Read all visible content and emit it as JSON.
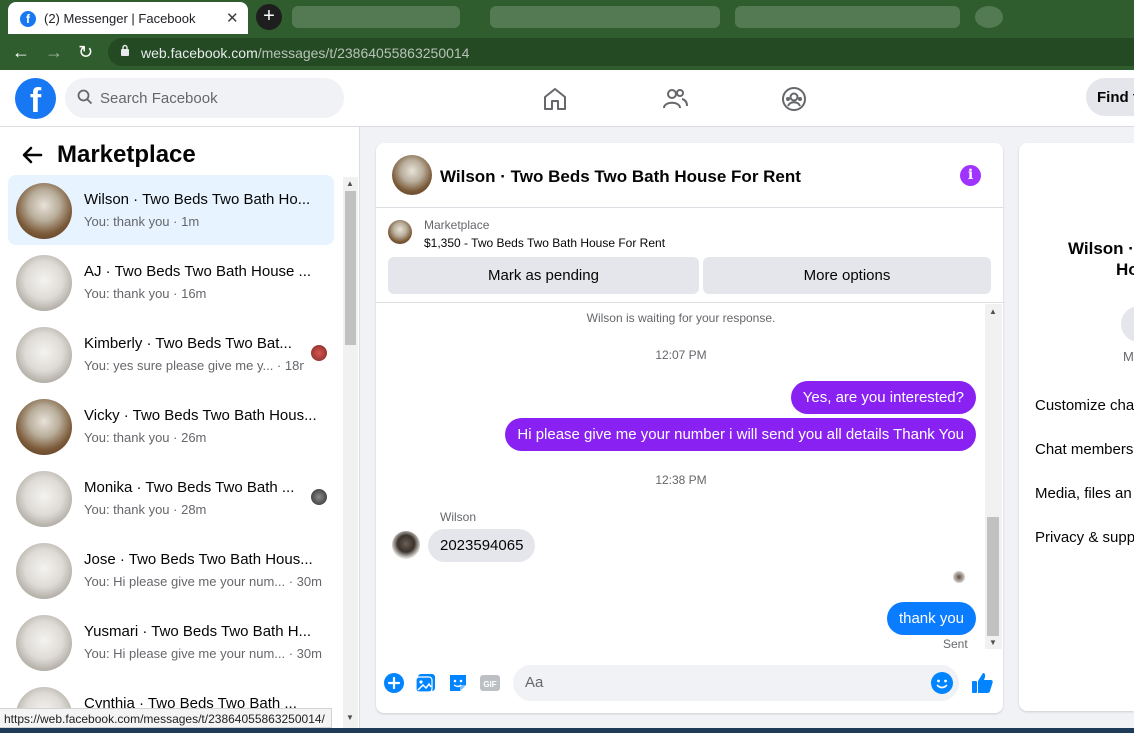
{
  "browser": {
    "active_tab_title": "(2) Messenger | Facebook",
    "new_tab_label": "+",
    "url_host": "web.facebook.com",
    "url_path": "/messages/t/23864055863250014",
    "status_url": "https://web.facebook.com/messages/t/23864055863250014/"
  },
  "facebook": {
    "search_placeholder": "Search Facebook",
    "find_label": "Find f"
  },
  "sidebar": {
    "title": "Marketplace",
    "conversations": [
      {
        "name": "Wilson · Two Beds Two Bath Ho...",
        "sub": "You: thank you · 1m",
        "avatar": "wood",
        "selected": true
      },
      {
        "name": "AJ · Two Beds Two Bath House ...",
        "sub": "You: thank you · 16m",
        "avatar": "white"
      },
      {
        "name": "Kimberly · Two Beds Two Bat...",
        "sub": "You: yes sure please give me y... · 18m",
        "avatar": "white"
      },
      {
        "name": "Vicky · Two Beds Two Bath Hous...",
        "sub": "You: thank you · 26m",
        "avatar": "wood"
      },
      {
        "name": "Monika · Two Beds Two Bath ...",
        "sub": "You: thank you · 28m",
        "avatar": "white"
      },
      {
        "name": "Jose · Two Beds Two Bath Hous...",
        "sub": "You: Hi please give me your num... · 30m",
        "avatar": "white"
      },
      {
        "name": "Yusmari · Two Beds Two Bath H...",
        "sub": "You: Hi please give me your num... · 30m",
        "avatar": "white"
      },
      {
        "name": "Cynthia · Two Beds Two Bath ...",
        "sub": "",
        "avatar": "white"
      }
    ]
  },
  "chat": {
    "title": "Wilson · Two Beds Two Bath House For Rent",
    "marketplace_label": "Marketplace",
    "listing": "$1,350 - Two Beds Two Bath House For Rent",
    "mark_pending": "Mark as pending",
    "more_options": "More options",
    "waiting_notice": "Wilson is waiting for your response.",
    "time1": "12:07 PM",
    "msg_out_1": "Yes, are you interested?",
    "msg_out_2": "Hi please give me your number i will send you all details Thank You",
    "time2": "12:38 PM",
    "sender_name": "Wilson",
    "msg_in_1": "2023594065",
    "msg_out_3": "thank you",
    "sent_label": "Sent",
    "input_placeholder": "Aa"
  },
  "details": {
    "name_line1": "Wilson ·",
    "name_line2": "Ho",
    "m_label": "M",
    "options": [
      "Customize cha",
      "Chat members",
      "Media, files an",
      "Privacy & supp"
    ]
  },
  "colors": {
    "messenger_accent": "#8a21f3",
    "facebook_blue": "#1877f2",
    "browser_green": "#2f5d2e"
  }
}
